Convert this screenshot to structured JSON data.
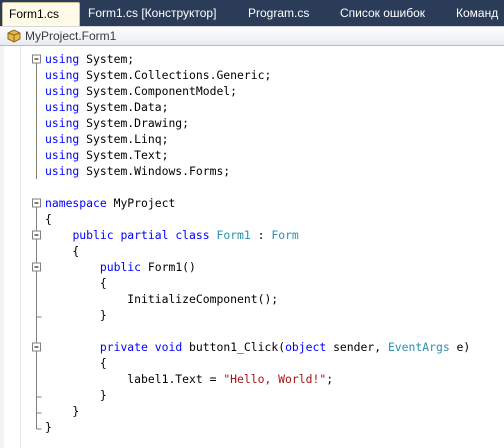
{
  "tabs": [
    {
      "label": "Form1.cs",
      "active": true
    },
    {
      "label": "Form1.cs [Конструктор]",
      "active": false
    },
    {
      "label": "Program.cs",
      "active": false
    },
    {
      "label": "Список ошибок",
      "active": false
    },
    {
      "label": "Команд",
      "active": false
    }
  ],
  "navbar": {
    "label": "MyProject.Form1",
    "icon": "class-icon"
  },
  "colors": {
    "tabbar_bg": "#2b3c59",
    "active_tab_bg": "#fffbe8",
    "keyword": "#0000ff",
    "type": "#2b91af",
    "string": "#a31515",
    "outline": "#808080"
  },
  "code": [
    [
      {
        "t": "using",
        "c": "kw"
      },
      {
        "t": " System;"
      }
    ],
    [
      {
        "t": "using",
        "c": "kw"
      },
      {
        "t": " System.Collections.Generic;"
      }
    ],
    [
      {
        "t": "using",
        "c": "kw"
      },
      {
        "t": " System.ComponentModel;"
      }
    ],
    [
      {
        "t": "using",
        "c": "kw"
      },
      {
        "t": " System.Data;"
      }
    ],
    [
      {
        "t": "using",
        "c": "kw"
      },
      {
        "t": " System.Drawing;"
      }
    ],
    [
      {
        "t": "using",
        "c": "kw"
      },
      {
        "t": " System.Linq;"
      }
    ],
    [
      {
        "t": "using",
        "c": "kw"
      },
      {
        "t": " System.Text;"
      }
    ],
    [
      {
        "t": "using",
        "c": "kw"
      },
      {
        "t": " System.Windows.Forms;"
      }
    ],
    [],
    [
      {
        "t": "namespace",
        "c": "kw"
      },
      {
        "t": " MyProject"
      }
    ],
    [
      {
        "t": "{"
      }
    ],
    [
      {
        "t": "    "
      },
      {
        "t": "public",
        "c": "kw"
      },
      {
        "t": " "
      },
      {
        "t": "partial",
        "c": "kw"
      },
      {
        "t": " "
      },
      {
        "t": "class",
        "c": "kw"
      },
      {
        "t": " "
      },
      {
        "t": "Form1",
        "c": "ty"
      },
      {
        "t": " : "
      },
      {
        "t": "Form",
        "c": "ty"
      }
    ],
    [
      {
        "t": "    {"
      }
    ],
    [
      {
        "t": "        "
      },
      {
        "t": "public",
        "c": "kw"
      },
      {
        "t": " Form1()"
      }
    ],
    [
      {
        "t": "        {"
      }
    ],
    [
      {
        "t": "            InitializeComponent();"
      }
    ],
    [
      {
        "t": "        }"
      }
    ],
    [],
    [
      {
        "t": "        "
      },
      {
        "t": "private",
        "c": "kw"
      },
      {
        "t": " "
      },
      {
        "t": "void",
        "c": "kw"
      },
      {
        "t": " button1_Click("
      },
      {
        "t": "object",
        "c": "kw"
      },
      {
        "t": " sender, "
      },
      {
        "t": "EventArgs",
        "c": "ty"
      },
      {
        "t": " e)"
      }
    ],
    [
      {
        "t": "        {"
      }
    ],
    [
      {
        "t": "            label1.Text = "
      },
      {
        "t": "\"Hello, World!\"",
        "c": "st"
      },
      {
        "t": ";"
      }
    ],
    [
      {
        "t": "        }"
      }
    ],
    [
      {
        "t": "    }"
      }
    ],
    [
      {
        "t": "}"
      }
    ]
  ]
}
